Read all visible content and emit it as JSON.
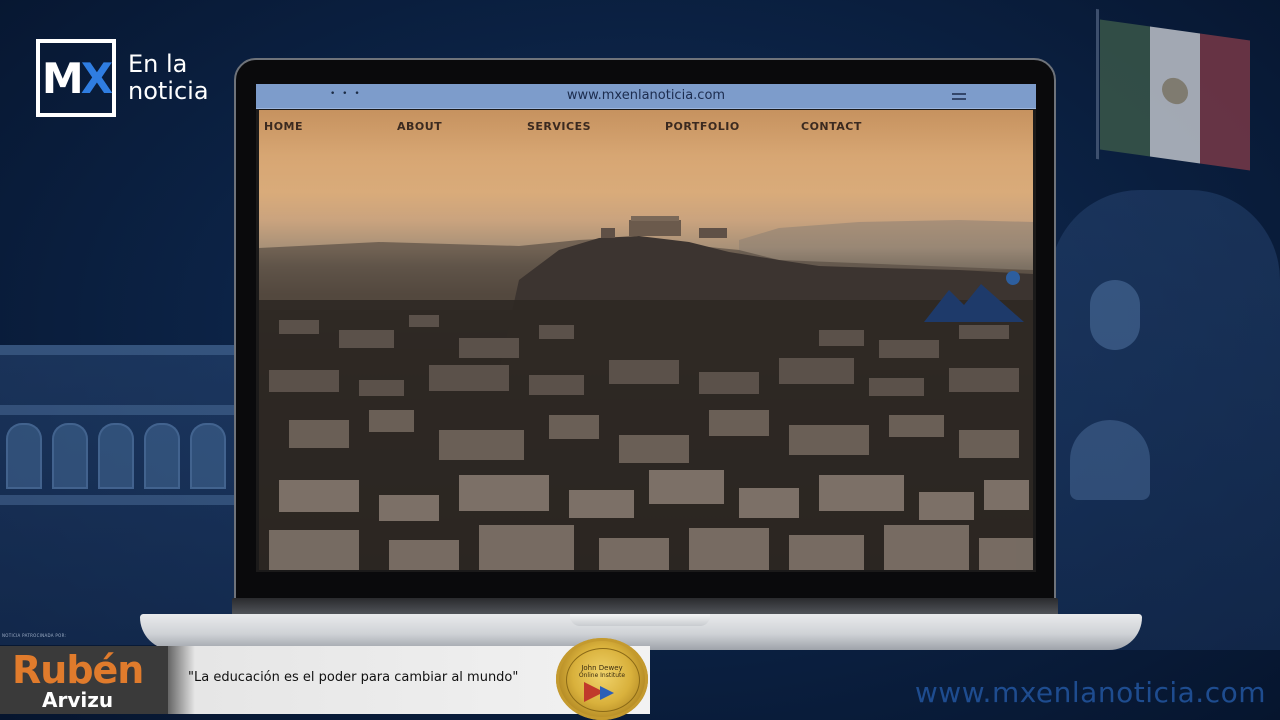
{
  "brand": {
    "logo_mark_m": "M",
    "logo_mark_x": "X",
    "logo_line1": "En la",
    "logo_line2": "noticia"
  },
  "browser": {
    "dots": "• • •",
    "url": "www.mxenlanoticia.com"
  },
  "site_nav": [
    {
      "label": "HOME"
    },
    {
      "label": "ABOUT"
    },
    {
      "label": "SERVICES"
    },
    {
      "label": "PORTFOLIO"
    },
    {
      "label": "CONTACT"
    }
  ],
  "banner": {
    "sponsor_tag": "NOTICIA PATROCINADA POR:",
    "name_first": "Rubén",
    "name_last": "Arvizu",
    "quote": "\"La educación es el poder para cambiar al mundo\"",
    "seal_line1": "John Dewey",
    "seal_line2": "Online Institute"
  },
  "footer": {
    "url": "www.mxenlanoticia.com"
  },
  "colors": {
    "background": "#0c2346",
    "accent_blue": "#2f7de1",
    "orange": "#e07b2c",
    "browser_bar": "#7d9ccb"
  }
}
